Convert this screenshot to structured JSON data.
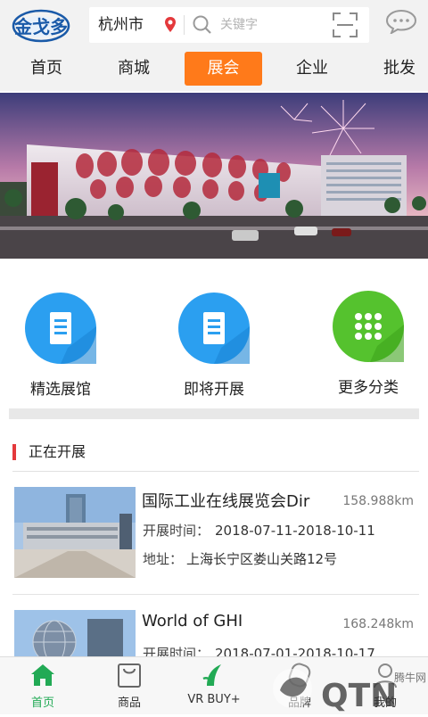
{
  "header": {
    "logo_text": "金戈多",
    "city": "杭州市",
    "search_placeholder": "关键字"
  },
  "tabs": [
    {
      "label": "首页"
    },
    {
      "label": "商城"
    },
    {
      "label": "展会",
      "active": true
    },
    {
      "label": "企业"
    },
    {
      "label": "批发"
    }
  ],
  "categories": [
    {
      "label": "精选展馆",
      "icon": "building-icon",
      "color": "#2b9ff0"
    },
    {
      "label": "即将开展",
      "icon": "building-icon",
      "color": "#2b9ff0"
    },
    {
      "label": "更多分类",
      "icon": "grid-dots-icon",
      "color": "#55c22e"
    }
  ],
  "section": {
    "title": "正在开展"
  },
  "exhibitions": [
    {
      "title": "国际工业在线展览会Dir",
      "distance": "158.988km",
      "time_label": "开展时间：",
      "time_value": "2018-07-11-2018-10-11",
      "addr_label": "地址：",
      "addr_value": "上海长宁区娄山关路12号"
    },
    {
      "title": "World of GHI",
      "distance": "168.248km",
      "time_label": "开展时间：",
      "time_value": "2018-07-01-2018-10-17"
    }
  ],
  "bottom_nav": [
    {
      "label": "首页",
      "icon": "home-icon",
      "active": true
    },
    {
      "label": "商品",
      "icon": "bag-icon"
    },
    {
      "label": "VR BUY+",
      "icon": "vr-icon"
    },
    {
      "label": "品牌",
      "icon": "tag-icon"
    },
    {
      "label": "我的",
      "icon": "user-icon"
    }
  ],
  "watermark": {
    "text": "QTN",
    "subtext": "腾牛网"
  },
  "colors": {
    "accent": "#ff7a1a",
    "section_bar": "#e4393c",
    "active_nav": "#22aa55",
    "icon_blue": "#2b9ff0",
    "icon_green": "#55c22e"
  }
}
